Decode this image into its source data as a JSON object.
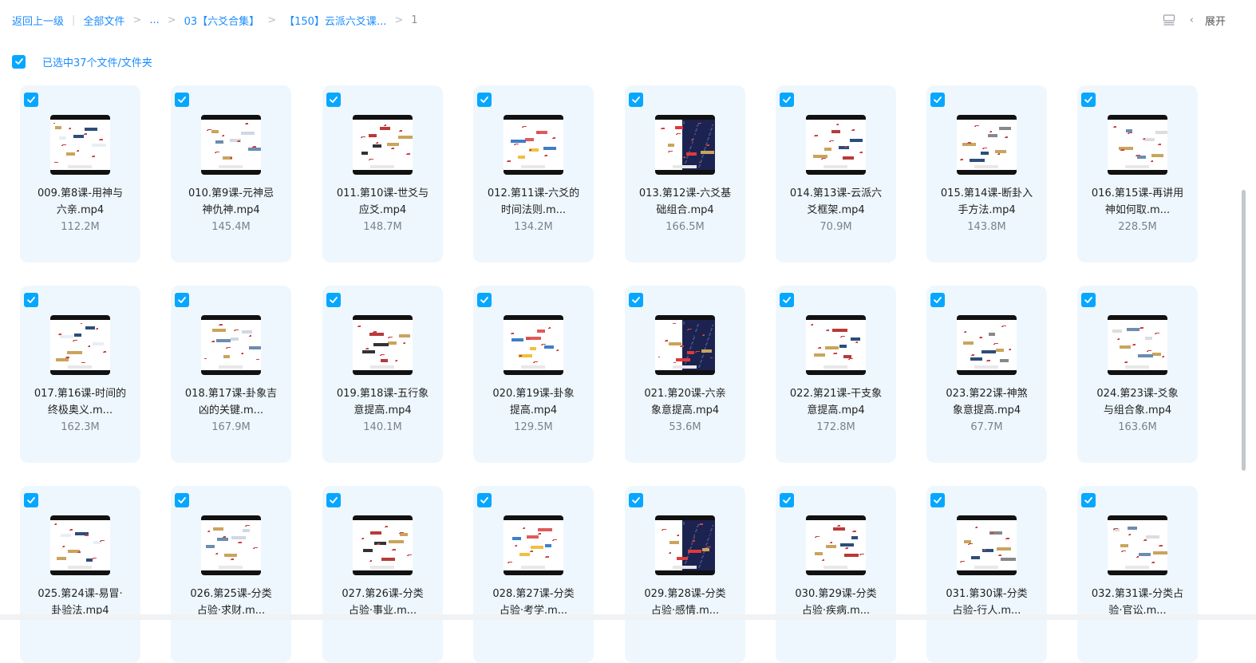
{
  "breadcrumb": {
    "back": "返回上一级",
    "all_files": "全部文件",
    "ellipsis": "...",
    "level1": "03【六爻合集】",
    "level2": "【150】云派六爻课...",
    "current": "1"
  },
  "toolbar": {
    "list_view_icon": "list-view-icon",
    "expand_label": "展开"
  },
  "selection": {
    "text": "已选中37个文件/文件夹",
    "accent": "#06a7ff"
  },
  "files": [
    {
      "name1": "009.第8课-用神与",
      "name2": "六亲.mp4",
      "size": "112.2M"
    },
    {
      "name1": "010.第9课-元神忌",
      "name2": "神仇神.mp4",
      "size": "145.4M"
    },
    {
      "name1": "011.第10课-世爻与",
      "name2": "应爻.mp4",
      "size": "148.7M"
    },
    {
      "name1": "012.第11课-六爻的",
      "name2": "时间法则.m...",
      "size": "134.2M"
    },
    {
      "name1": "013.第12课-六爻基",
      "name2": "础组合.mp4",
      "size": "166.5M"
    },
    {
      "name1": "014.第13课-云派六",
      "name2": "爻框架.mp4",
      "size": "70.9M"
    },
    {
      "name1": "015.第14课-断卦入",
      "name2": "手方法.mp4",
      "size": "143.8M"
    },
    {
      "name1": "016.第15课-再讲用",
      "name2": "神如何取.m...",
      "size": "228.5M"
    },
    {
      "name1": "017.第16课-时间的",
      "name2": "终极奥义.m...",
      "size": "162.3M"
    },
    {
      "name1": "018.第17课-卦象吉",
      "name2": "凶的关键.m...",
      "size": "167.9M"
    },
    {
      "name1": "019.第18课-五行象",
      "name2": "意提高.mp4",
      "size": "140.1M"
    },
    {
      "name1": "020.第19课-卦象",
      "name2": "提高.mp4",
      "size": "129.5M"
    },
    {
      "name1": "021.第20课-六亲",
      "name2": "象意提高.mp4",
      "size": "53.6M"
    },
    {
      "name1": "022.第21课-干支象",
      "name2": "意提高.mp4",
      "size": "172.8M"
    },
    {
      "name1": "023.第22课-神煞",
      "name2": "象意提高.mp4",
      "size": "67.7M"
    },
    {
      "name1": "024.第23课-爻象",
      "name2": "与组合象.mp4",
      "size": "163.6M"
    },
    {
      "name1": "025.第24课-易冒·",
      "name2": "卦验法.mp4",
      "size": ""
    },
    {
      "name1": "026.第25课-分类",
      "name2": "占验·求财.m...",
      "size": ""
    },
    {
      "name1": "027.第26课-分类",
      "name2": "占验·事业.m...",
      "size": ""
    },
    {
      "name1": "028.第27课-分类",
      "name2": "占验·考学.m...",
      "size": ""
    },
    {
      "name1": "029.第28课-分类",
      "name2": "占验·感情.m...",
      "size": ""
    },
    {
      "name1": "030.第29课-分类",
      "name2": "占验·疾病.m...",
      "size": ""
    },
    {
      "name1": "031.第30课-分类",
      "name2": "占验-行人.m...",
      "size": ""
    },
    {
      "name1": "032.第31课-分类占",
      "name2": "验·官讼.m...",
      "size": ""
    }
  ]
}
